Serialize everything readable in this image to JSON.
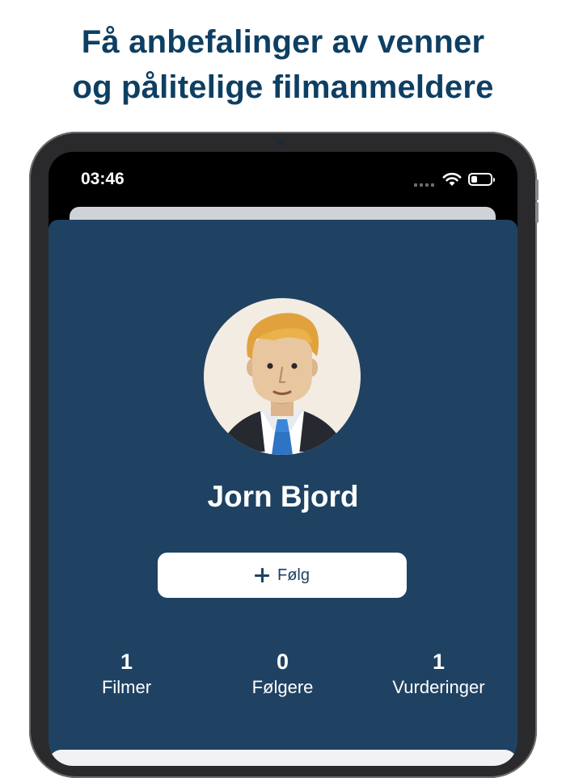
{
  "headline": {
    "line1": "Få anbefalinger av venner",
    "line2": "og pålitelige filmanmeldere"
  },
  "status_bar": {
    "time": "03:46",
    "icons": [
      "cellular-signal-icon",
      "wifi-icon",
      "battery-icon"
    ]
  },
  "profile": {
    "name": "Jorn Bjord",
    "avatar_icon": "man-avatar-icon",
    "follow_label": "Følg",
    "follow_icon": "plus-icon",
    "stats": [
      {
        "value": "1",
        "label": "Filmer"
      },
      {
        "value": "0",
        "label": "Følgere"
      },
      {
        "value": "1",
        "label": "Vurderinger"
      }
    ]
  },
  "colors": {
    "headline": "#0e3f63",
    "profile_background": "#1f4263",
    "button_background": "#ffffff"
  }
}
